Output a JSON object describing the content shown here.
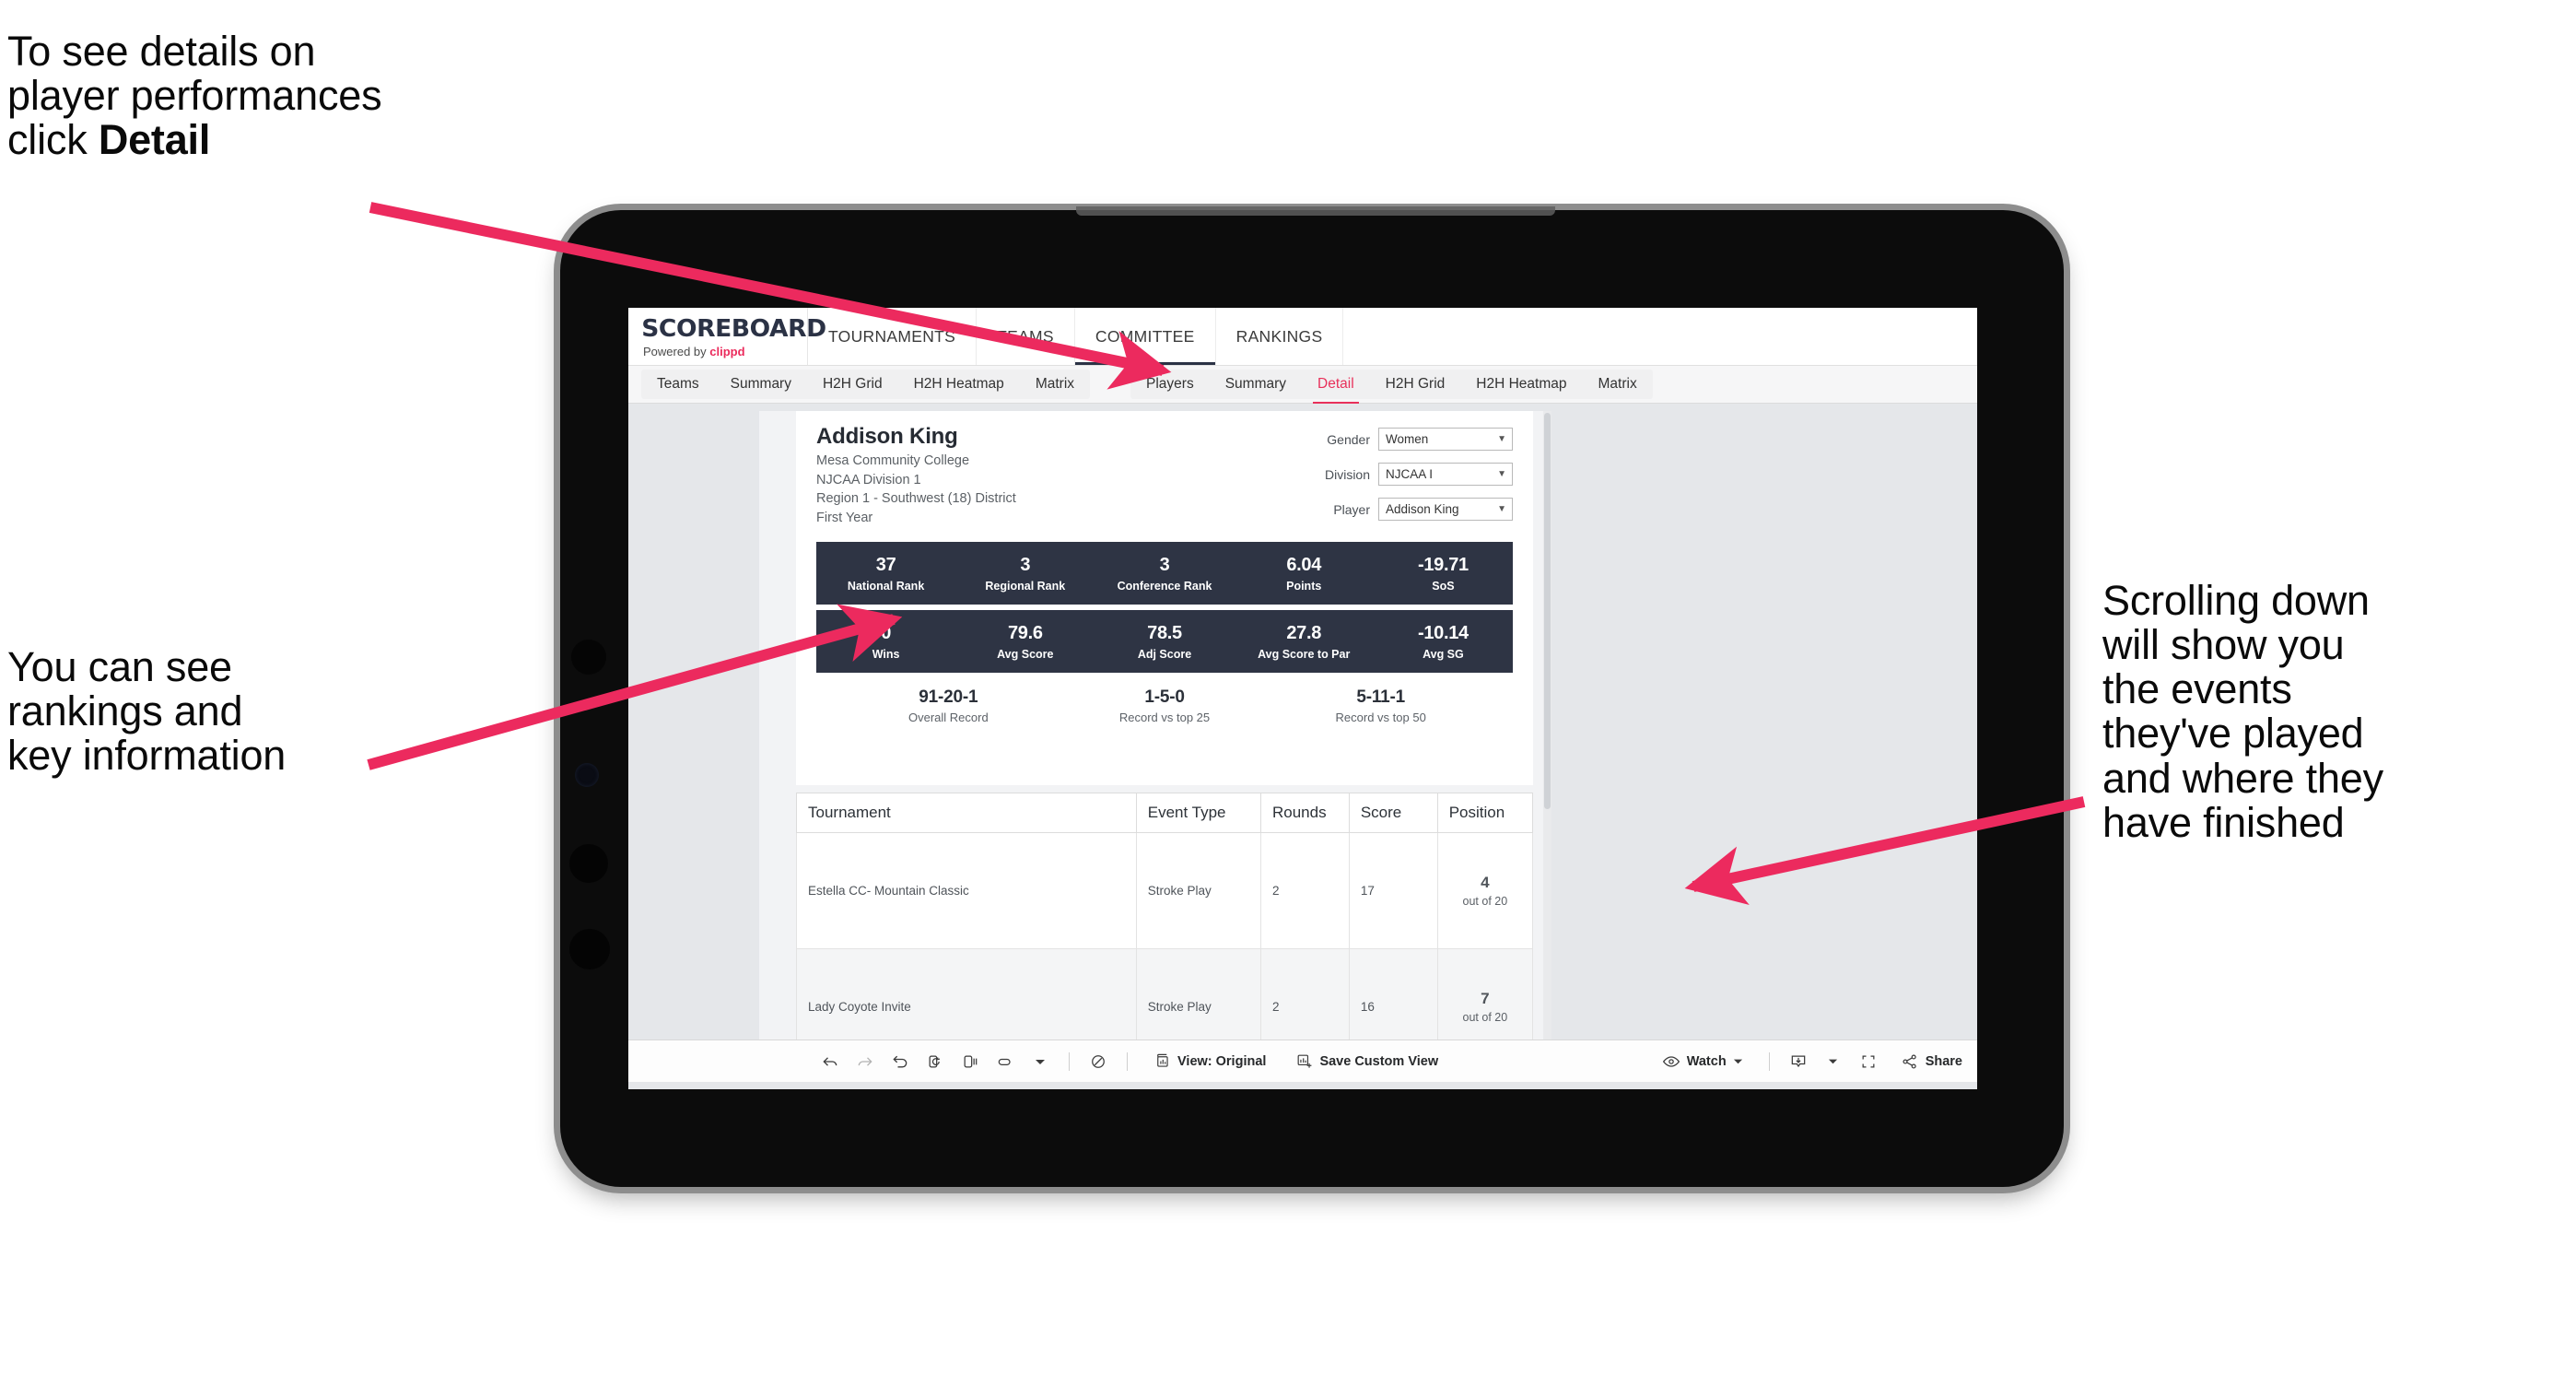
{
  "annotations": {
    "detail": "To see details on\nplayer performances\nclick ",
    "detail_bold": "Detail",
    "rankings": "You can see\nrankings and\nkey information",
    "scrolling": "Scrolling down\nwill show you\nthe events\nthey've played\nand where they\nhave finished",
    "arrow_color": "#ec2a5e"
  },
  "app": {
    "brand": {
      "logo": "SCOREBOARD",
      "powered_prefix": "Powered by ",
      "powered_brand": "clippd"
    },
    "top_nav": [
      {
        "label": "TOURNAMENTS",
        "active": false
      },
      {
        "label": "TEAMS",
        "active": false
      },
      {
        "label": "COMMITTEE",
        "active": true
      },
      {
        "label": "RANKINGS",
        "active": false
      }
    ],
    "tab_group_left": [
      {
        "label": "Teams",
        "selected": false
      },
      {
        "label": "Summary",
        "selected": false
      },
      {
        "label": "H2H Grid",
        "selected": false
      },
      {
        "label": "H2H Heatmap",
        "selected": false
      },
      {
        "label": "Matrix",
        "selected": false
      }
    ],
    "tab_group_right": [
      {
        "label": "Players",
        "selected": false
      },
      {
        "label": "Summary",
        "selected": false
      },
      {
        "label": "Detail",
        "selected": true
      },
      {
        "label": "H2H Grid",
        "selected": false
      },
      {
        "label": "H2H Heatmap",
        "selected": false
      },
      {
        "label": "Matrix",
        "selected": false
      }
    ]
  },
  "player": {
    "name": "Addison King",
    "college": "Mesa Community College",
    "division": "NJCAA Division 1",
    "region": "Region 1 - Southwest (18) District",
    "year": "First Year"
  },
  "filters": [
    {
      "label": "Gender",
      "value": "Women"
    },
    {
      "label": "Division",
      "value": "NJCAA I"
    },
    {
      "label": "Player",
      "value": "Addison King"
    }
  ],
  "stats_row1": [
    {
      "value": "37",
      "label": "National Rank"
    },
    {
      "value": "3",
      "label": "Regional Rank"
    },
    {
      "value": "3",
      "label": "Conference Rank"
    },
    {
      "value": "6.04",
      "label": "Points"
    },
    {
      "value": "-19.71",
      "label": "SoS"
    }
  ],
  "stats_row2": [
    {
      "value": "0",
      "label": "Wins"
    },
    {
      "value": "79.6",
      "label": "Avg Score"
    },
    {
      "value": "78.5",
      "label": "Adj Score"
    },
    {
      "value": "27.8",
      "label": "Avg Score to Par"
    },
    {
      "value": "-10.14",
      "label": "Avg SG"
    }
  ],
  "records": [
    {
      "value": "91-20-1",
      "label": "Overall Record"
    },
    {
      "value": "1-5-0",
      "label": "Record vs top 25"
    },
    {
      "value": "5-11-1",
      "label": "Record vs top 50"
    }
  ],
  "table": {
    "columns": [
      "Tournament",
      "Event Type",
      "Rounds",
      "Score",
      "Position"
    ],
    "rows": [
      {
        "tournament": "Estella CC- Mountain Classic",
        "event_type": "Stroke Play",
        "rounds": "2",
        "score": "17",
        "position": "4",
        "position_sub": "out of 20"
      },
      {
        "tournament": "Lady Coyote Invite",
        "event_type": "Stroke Play",
        "rounds": "2",
        "score": "16",
        "position": "7",
        "position_sub": "out of 20"
      }
    ]
  },
  "toolbar": {
    "view_label": "View: Original",
    "save_label": "Save Custom View",
    "watch_label": "Watch",
    "share_label": "Share"
  },
  "colors": {
    "stat_bar_bg": "#2e3444",
    "accent_pink": "#e8305a",
    "brand_dark": "#2b3245"
  }
}
